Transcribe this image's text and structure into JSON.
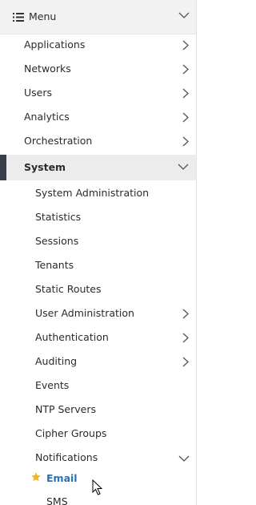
{
  "menu": {
    "title": "Menu"
  },
  "nav": {
    "top_items": [
      {
        "label": "Applications"
      },
      {
        "label": "Networks"
      },
      {
        "label": "Users"
      },
      {
        "label": "Analytics"
      },
      {
        "label": "Orchestration"
      }
    ],
    "system": {
      "label": "System",
      "children": [
        {
          "label": "System Administration"
        },
        {
          "label": "Statistics"
        },
        {
          "label": "Sessions"
        },
        {
          "label": "Tenants"
        },
        {
          "label": "Static Routes"
        },
        {
          "label": "User Administration"
        },
        {
          "label": "Authentication"
        },
        {
          "label": "Auditing"
        },
        {
          "label": "Events"
        },
        {
          "label": "NTP Servers"
        },
        {
          "label": "Cipher Groups"
        },
        {
          "label": "Notifications"
        }
      ],
      "notifications_children": [
        {
          "label": "Email",
          "icon": "star-icon",
          "active": true
        },
        {
          "label": "SMS"
        }
      ]
    }
  },
  "colors": {
    "selected_bar": "#3a3d4a",
    "active_text": "#2c6fb2",
    "star": "#f3b51c",
    "header_bg": "#f2f2f2"
  }
}
